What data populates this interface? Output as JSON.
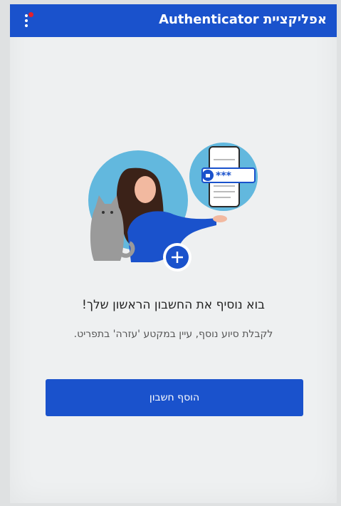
{
  "appbar": {
    "title": "אפליקציית Authenticator",
    "menu_icon": "more-vertical-icon",
    "notification_color": "#e3202c"
  },
  "main": {
    "headline": "בוא נוסיף את החשבון הראשון שלך!",
    "subtext": "לקבלת סיוע נוסף, עיין במקטע 'עזרה' בתפריט.",
    "password_mask": "***",
    "add_button_label": "הוסף חשבון"
  },
  "colors": {
    "brand_blue": "#1a52cc",
    "accent_light_blue": "#62b8de"
  }
}
